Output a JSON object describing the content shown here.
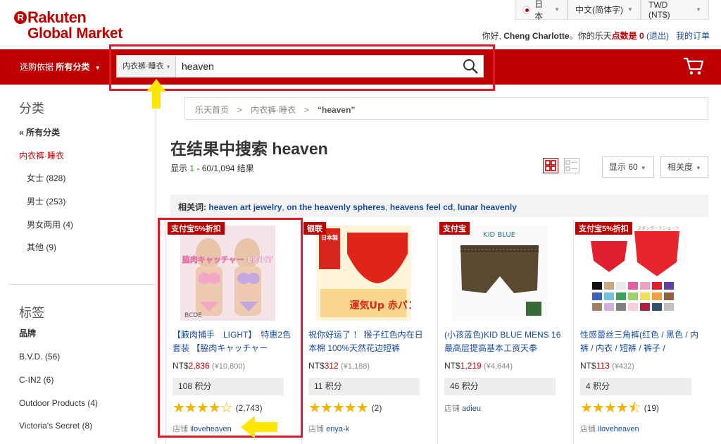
{
  "header": {
    "logo_line1": "Rakuten",
    "logo_r": "R",
    "logo_line2": "Global Market",
    "region": "日本",
    "language": "中文(简体字)",
    "currency": "TWD (NT$)",
    "greeting_prefix": "你好,",
    "user_name": "Cheng Charlotte",
    "greeting_mid": "。你的乐天",
    "points_label": "点数是",
    "points_value": "0",
    "logout": "(退出)",
    "my_orders": "我的订单"
  },
  "searchbar": {
    "scope_label": "选购依据",
    "scope_value": "所有分类",
    "category": "内衣裤·睡衣",
    "query": "heaven"
  },
  "breadcrumb": {
    "home": "乐天首页",
    "category": "内衣裤·睡衣",
    "current": "“heaven”"
  },
  "results": {
    "heading": "在结果中搜索 heaven",
    "count_prefix": "显示",
    "count_range_start": "1",
    "count_range_rest": "- 60/1,094 结果",
    "display_select": "显示 60",
    "sort_select": "相关度"
  },
  "related": {
    "label": "相关词:",
    "terms": [
      "heaven art jewelry",
      "on the heavenly spheres",
      "heavens feel cd",
      "lunar heavenly"
    ]
  },
  "sidebar": {
    "category_heading": "分类",
    "all_categories": "« 所有分类",
    "current_category": "内衣裤·睡衣",
    "subcategories": [
      {
        "label": "女士 (828)"
      },
      {
        "label": "男士 (253)"
      },
      {
        "label": "男女两用 (4)"
      },
      {
        "label": "其他 (9)"
      }
    ],
    "tags_heading": "标签",
    "brand_heading": "品牌",
    "brands": [
      {
        "label": "B.V.D. (56)"
      },
      {
        "label": "C-IN2 (6)"
      },
      {
        "label": "Outdoor Products (4)"
      },
      {
        "label": "Victoria's Secret (8)"
      }
    ]
  },
  "products": [
    {
      "badge": "支付宝5%折扣",
      "title": "【腋肉捕手　LIGHT】　特惠2色套装 【脇肉キャッチャー",
      "price_prefix": "NT$",
      "price": "2,836",
      "yen": "(¥10,800)",
      "points": "108 积分",
      "rating": 4,
      "reviews": "(2,743)",
      "shop_label": "店铺",
      "shop": "iloveheaven",
      "img_text": "脇肉キャッチャー LIGHT",
      "img_text2": "BCDE"
    },
    {
      "badge": "银联",
      "title": "祝你好运了 ！ 猴子红色内在日本棉 100%天然花边短裤",
      "price_prefix": "NT$",
      "price": "312",
      "yen": "(¥1,188)",
      "points": "11 积分",
      "rating": 5,
      "reviews": "(2)",
      "shop_label": "店铺",
      "shop": "enya-k",
      "img_text": "運気Up 赤パン",
      "img_text2": "日本製"
    },
    {
      "badge": "支付宝",
      "title": "(小孩蓝色)KID BLUE MENS 16最高层提高基本工资天拳",
      "price_prefix": "NT$",
      "price": "1,219",
      "yen": "(¥4,644)",
      "points": "46 积分",
      "rating": 0,
      "reviews": "",
      "shop_label": "店铺",
      "shop": "adieu",
      "img_text": "KID BLUE",
      "img_text2": ""
    },
    {
      "badge": "支付宝5%折扣",
      "title": "性感蕾丝三角裤(红色 / 黑色 / 内裤 / 内衣 / 短裤 / 裤子 /",
      "price_prefix": "NT$",
      "price": "113",
      "yen": "(¥432)",
      "points": "4 积分",
      "rating": 4.5,
      "reviews": "(19)",
      "shop_label": "店铺",
      "shop": "iloveheaven",
      "img_text": "スタンダードショーツ",
      "img_text2": ""
    }
  ],
  "colors": {
    "brand_red": "#bf0000",
    "link_blue": "#1a4b9b",
    "star": "#f0b400",
    "highlight": "#e0192a",
    "arrow": "#ffe600"
  }
}
